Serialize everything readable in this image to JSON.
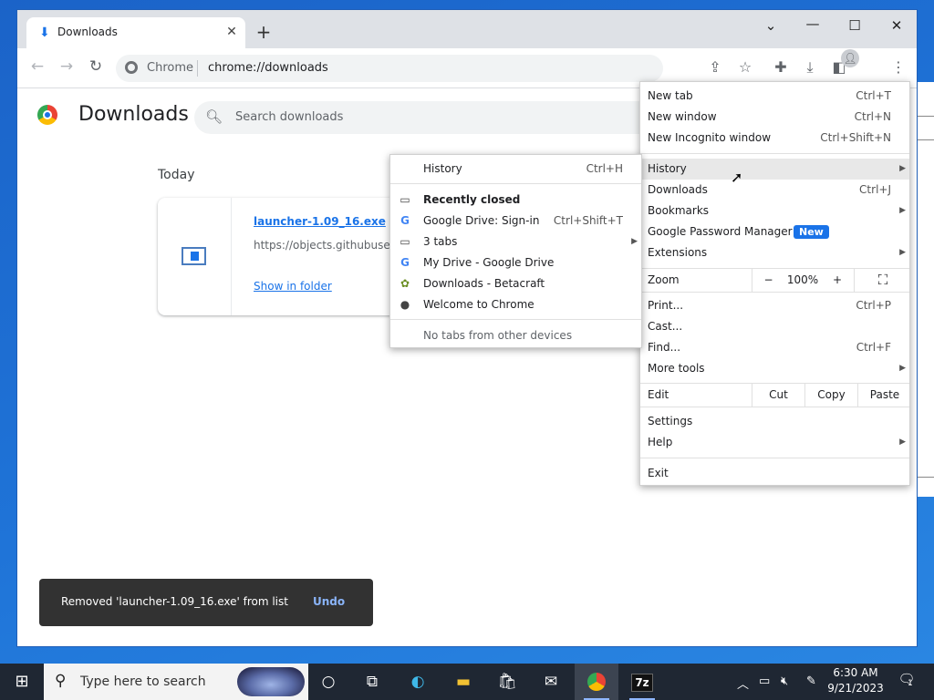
{
  "window": {
    "tab_title": "Downloads",
    "new_tab_symbol": "+",
    "controls": {
      "dropdown": "⌄",
      "minimize": "—",
      "maximize": "☐",
      "close": "✕"
    }
  },
  "toolbar": {
    "chip": "Chrome",
    "url": "chrome://downloads"
  },
  "page": {
    "title": "Downloads",
    "search_placeholder": "Search downloads",
    "section_label": "Today",
    "item": {
      "filename": "launcher-1.09_16.exe",
      "url": "https://objects.githubuser",
      "action": "Show in folder"
    }
  },
  "toast": {
    "message": "Removed 'launcher-1.09_16.exe' from list",
    "action": "Undo"
  },
  "main_menu": {
    "new_tab": {
      "label": "New tab",
      "shortcut": "Ctrl+T"
    },
    "new_window": {
      "label": "New window",
      "shortcut": "Ctrl+N"
    },
    "new_incognito": {
      "label": "New Incognito window",
      "shortcut": "Ctrl+Shift+N"
    },
    "history": {
      "label": "History"
    },
    "downloads": {
      "label": "Downloads",
      "shortcut": "Ctrl+J"
    },
    "bookmarks": {
      "label": "Bookmarks"
    },
    "password_manager": {
      "label": "Google Password Manager",
      "badge": "New"
    },
    "extensions": {
      "label": "Extensions"
    },
    "zoom": {
      "label": "Zoom",
      "minus": "−",
      "value": "100%",
      "plus": "+"
    },
    "print": {
      "label": "Print...",
      "shortcut": "Ctrl+P"
    },
    "cast": {
      "label": "Cast..."
    },
    "find": {
      "label": "Find...",
      "shortcut": "Ctrl+F"
    },
    "more_tools": {
      "label": "More tools"
    },
    "edit": {
      "label": "Edit",
      "cut": "Cut",
      "copy": "Copy",
      "paste": "Paste"
    },
    "settings": {
      "label": "Settings"
    },
    "help": {
      "label": "Help"
    },
    "exit": {
      "label": "Exit"
    }
  },
  "history_submenu": {
    "history": {
      "label": "History",
      "shortcut": "Ctrl+H"
    },
    "recently_closed": "Recently closed",
    "items": [
      {
        "label": "Google Drive: Sign-in",
        "shortcut": "Ctrl+Shift+T",
        "icon": "google-icon"
      },
      {
        "label": "3 tabs",
        "icon": "tabs-icon"
      },
      {
        "label": "My Drive - Google Drive",
        "icon": "google-icon"
      },
      {
        "label": "Downloads - Betacraft",
        "icon": "betacraft-icon"
      },
      {
        "label": "Welcome to Chrome",
        "icon": "globe-icon"
      }
    ],
    "no_tabs": "No tabs from other devices"
  },
  "taskbar": {
    "search_placeholder": "Type here to search",
    "clock_time": "6:30 AM",
    "clock_date": "9/21/2023",
    "notification_count": "1"
  }
}
